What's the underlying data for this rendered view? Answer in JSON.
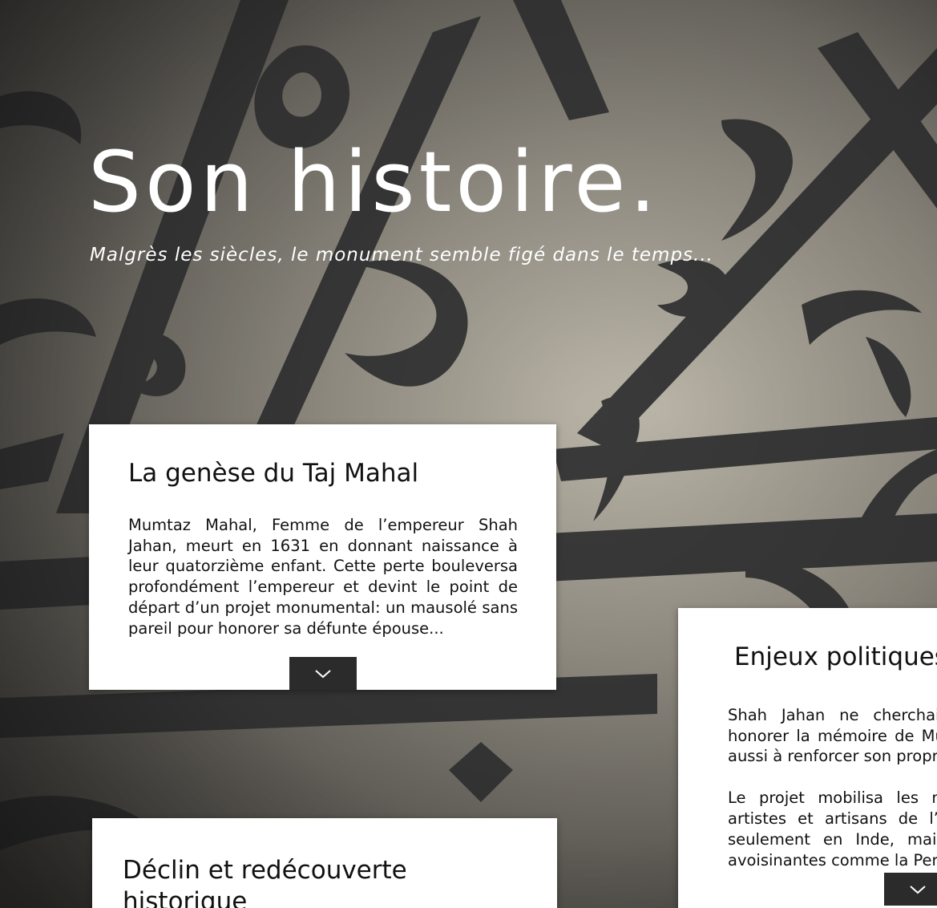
{
  "hero": {
    "title": "Son histoire.",
    "subtitle": "Malgrès les siècles, le monument semble figé dans le temps..."
  },
  "cards": [
    {
      "title": "La genèse du Taj Mahal",
      "paragraphs": [
        "Mumtaz Mahal, Femme de l’empereur Shah Jahan, meurt en 1631 en donnant naissance à leur quatorzième enfant. Cette perte bouleversa profondément l’empereur et devint le point de départ d’un projet monumental: un mausolé sans pareil pour honorer sa défunte épouse..."
      ],
      "toggle_icon": "chevron-down-icon"
    },
    {
      "title": "Enjeux politiques",
      "paragraphs": [
        "Shah Jahan ne cherchait pas seulement à honorer la mémoire de Mumtaz Mahal, il visait aussi à renforcer son propre prestige.",
        "Le projet mobilisa les meilleurs architectes, artistes et artisans de l’époque, venant non seulement en Inde, mais aussi des régions avoisinantes comme la Perse et l’Asie centrale..."
      ],
      "toggle_icon": "chevron-down-icon"
    },
    {
      "title": "Déclin et redécouverte historique"
    }
  ],
  "colors": {
    "card_bg": "#ffffff",
    "toggle_bg": "#2b2b2b",
    "hero_text": "#ffffff",
    "background_stone": "#9a958a",
    "calligraphy": "#3a3a3a"
  }
}
